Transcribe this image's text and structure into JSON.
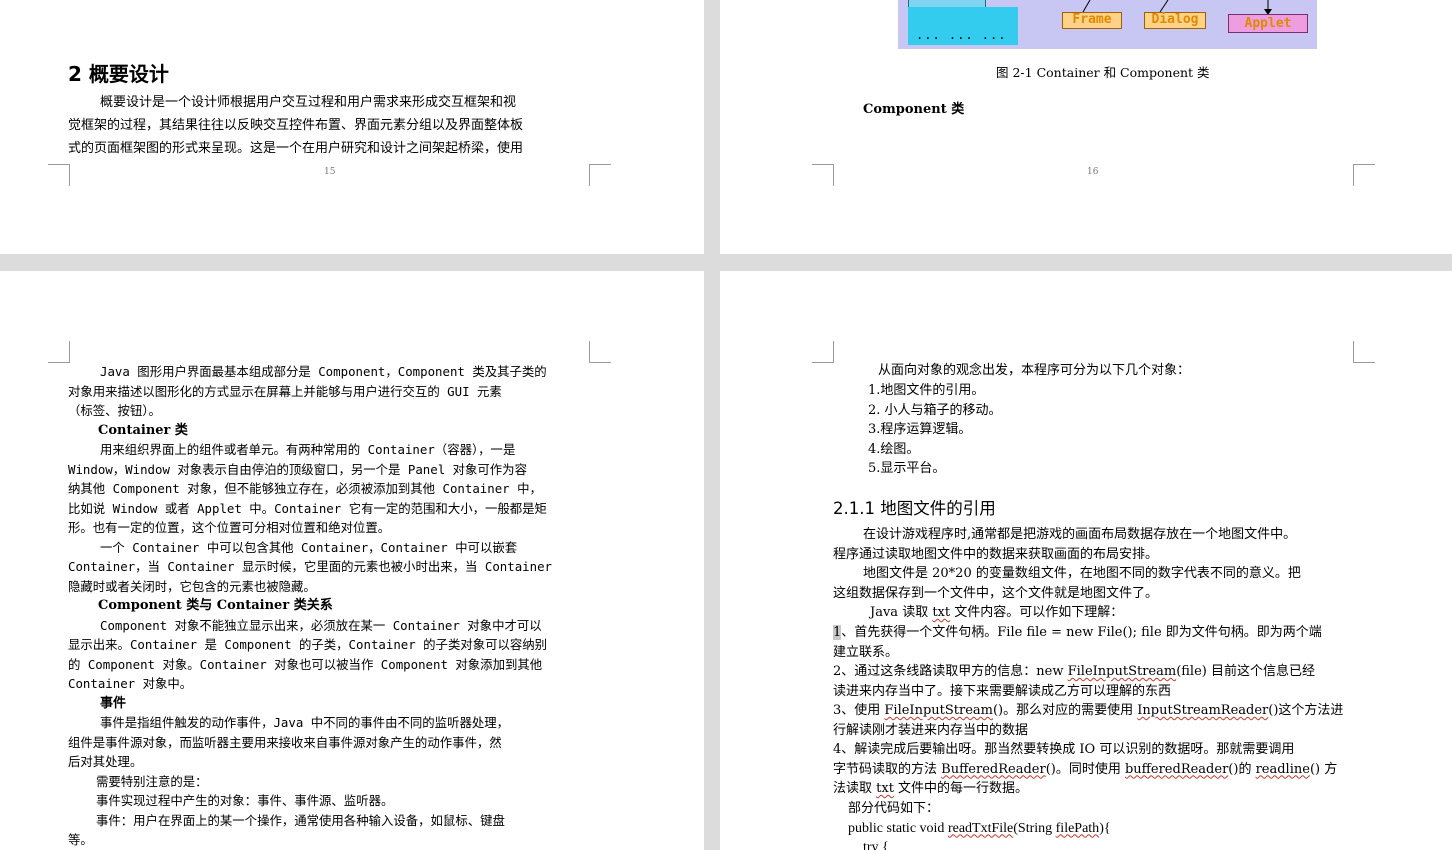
{
  "page15": {
    "heading": "2  概要设计",
    "lines": [
      "概要设计是一个设计师根据用户交互过程和用户需求来形成交互框架和视",
      "觉框架的过程，其结果往往以反映交互控件布置、界面元素分组以及界面整体板",
      "式的页面框架图的形式来呈现。这是一个在用户研究和设计之间架起桥梁，使用"
    ],
    "page_number": "15"
  },
  "page16": {
    "diagram": {
      "dots": "... ... ...",
      "frame_label": "Frame",
      "dialog_label": "Dialog",
      "applet_label": "Applet"
    },
    "caption": "图 2-1 Container 和 Component 类",
    "section_label": "Component 类",
    "page_number": "16"
  },
  "page17": {
    "p1": [
      "Java 图形用户界面最基本组成部分是 Component，Component 类及其子类的",
      "对象用来描述以图形化的方式显示在屏幕上并能够与用户进行交互的 GUI 元素",
      "（标签、按钮）。"
    ],
    "container_heading": "Container 类",
    "p2": [
      "用来组织界面上的组件或者单元。有两种常用的 Container（容器），一是",
      "Window，Window 对象表示自由停泊的顶级窗口，另一个是 Panel 对象可作为容",
      "纳其他 Component 对象，但不能够独立存在，必须被添加到其他 Container 中，",
      "比如说 Window 或者 Applet 中。Container 它有一定的范围和大小，一般都是矩",
      "形。也有一定的位置，这个位置可分相对位置和绝对位置。"
    ],
    "p3": [
      "一个 Container 中可以包含其他 Container，Container 中可以嵌套",
      "Container，当 Container 显示时候，它里面的元素也被小时出来，当 Container",
      "隐藏时或者关闭时，它包含的元素也被隐藏。"
    ],
    "relation_heading": "Component 类与 Container 类关系",
    "p4": [
      "Component 对象不能独立显示出来，必须放在某一 Container 对象中才可以",
      "显示出来。Container 是 Component 的子类，Container 的子类对象可以容纳别",
      "的 Component 对象。Container 对象也可以被当作 Component 对象添加到其他",
      "Container 对象中。"
    ],
    "event_heading": "事件",
    "p5": [
      "事件是指组件触发的动作事件，Java 中不同的事件由不同的监听器处理，",
      "组件是事件源对象，而监听器主要用来接收来自事件源对象产生的动作事件，然",
      "后对其处理。"
    ],
    "note": "需要特别注意的是：",
    "p6": "事件实现过程中产生的对象：事件、事件源、监听器。",
    "p7": [
      "事件：用户在界面上的某一个操作，通常使用各种输入设备，如鼠标、键盘",
      "等。"
    ]
  },
  "page18": {
    "intro": "从面向对象的观念出发，本程序可分为以下几个对象：",
    "list": [
      "1.地图文件的引用。",
      "2. 小人与箱子的移动。",
      "3.程序运算逻辑。",
      "4.绘图。",
      "5.显示平台。"
    ],
    "section_heading": "2.1.1   地图文件的引用",
    "s1": [
      "在设计游戏程序时,通常都是把游戏的画面布局数据存放在一个地图文件中。",
      "程序通过读取地图文件中的数据来获取画面的布局安排。"
    ],
    "s2": [
      "地图文件是 20*20 的变量数组文件，在地图不同的数字代表不同的意义。把",
      "这组数据保存到一个文件中，这个文件就是地图文件了。"
    ],
    "s3_pre": "Java 读取 ",
    "s3_txt": "txt",
    "s3_post": " 文件内容。可以作如下理解：",
    "step1_num": "1",
    "step1_a": "、首先获得一个文件句柄。File file = new File(); file 即为文件句柄。即为两个端",
    "step1_b": "建立联系。",
    "step2_a1": "2、通过这条线路读取甲方的信息：new ",
    "step2_w1": "FileInputStream",
    "step2_a2": "(file)  目前这个信息已经",
    "step2_b": "读进来内存当中了。接下来需要解读成乙方可以理解的东西",
    "step3_a1": "3、使用 ",
    "step3_w1": "FileInputStream",
    "step3_a2": "()。那么对应的需要使用 ",
    "step3_w2": "InputStreamReader",
    "step3_a3": "()这个方法进",
    "step3_b": "行解读刚才装进来内存当中的数据",
    "step4_a": "4、解读完成后要输出呀。那当然要转换成 IO 可以识别的数据呀。那就需要调用",
    "step4_b1": "字节码读取的方法 ",
    "step4_w1": "BufferedReader",
    "step4_b2": "()。同时使用 ",
    "step4_w2": "bufferedReader",
    "step4_b3": "()的 ",
    "step4_w3": "readline",
    "step4_b4": "()  方",
    "step4_c1": "法读取 ",
    "step4_w4": "txt",
    "step4_c2": " 文件中的每一行数据。",
    "code_label": "部分代码如下：",
    "code1_a": "public static void ",
    "code1_w1": "readTxtFile",
    "code1_b": "(String ",
    "code1_w2": "filePath",
    "code1_c": "){",
    "code2": "try {"
  }
}
